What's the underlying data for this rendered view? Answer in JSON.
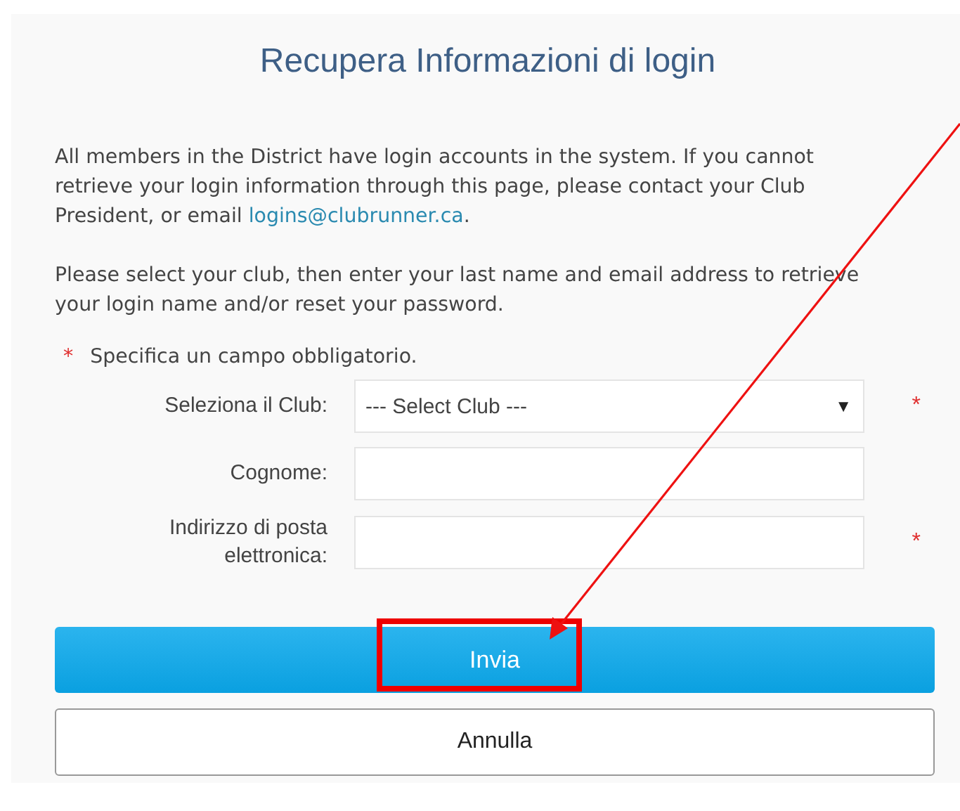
{
  "title": "Recupera Informazioni di login",
  "intro": {
    "text": "All members in the District have login accounts in the system. If you cannot retrieve your login information through this page, please contact your Club President, or email ",
    "link": "logins@clubrunner.ca",
    "after": "."
  },
  "instructions": "Please select your club, then enter your last name and email address to retrieve your login name and/or reset your password.",
  "required_note": {
    "mark": "*",
    "text": "Specifica un campo obbligatorio."
  },
  "fields": [
    {
      "kind": "select",
      "label": "Seleziona il Club:",
      "value": "--- Select Club ---",
      "caret": "▼",
      "required": true,
      "mark": "*"
    },
    {
      "kind": "text",
      "label": "Cognome:",
      "required": false
    },
    {
      "kind": "text",
      "label": "Indirizzo di posta elettronica:",
      "required": true,
      "mark": "*"
    }
  ],
  "buttons": [
    {
      "label": "Invia",
      "kind": "primary",
      "highlighted": true
    },
    {
      "label": "Annulla",
      "kind": "secondary",
      "highlighted": false
    }
  ]
}
